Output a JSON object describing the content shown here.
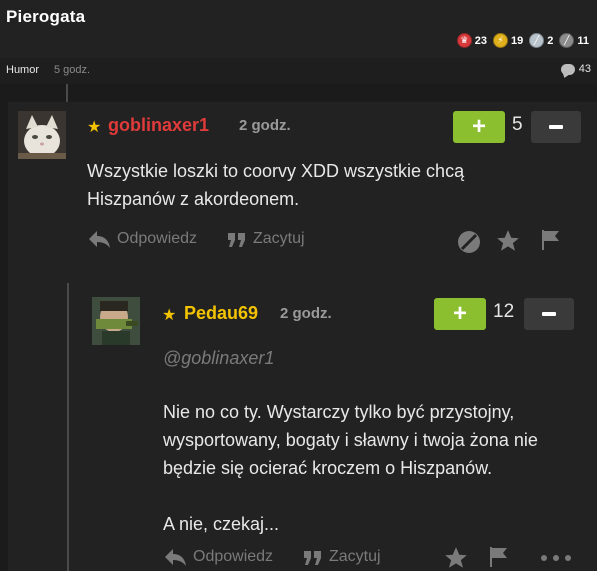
{
  "header": {
    "site_title": "Pierogata",
    "badges": [
      {
        "icon": "red-medal-icon",
        "count": "23",
        "color": "#d8393b"
      },
      {
        "icon": "gold-medal-icon",
        "count": "19",
        "color": "#e0b01c"
      },
      {
        "icon": "silver-medal-icon",
        "count": "2",
        "color": "#b8c3cc"
      },
      {
        "icon": "grey-medal-icon",
        "count": "11",
        "color": "#8c8c8c"
      }
    ]
  },
  "post_meta": {
    "category": "Humor",
    "time": "5 godz.",
    "comment_count": "43"
  },
  "comments": [
    {
      "username": "goblinaxer1",
      "username_color": "#e03a3a",
      "time": "2 godz.",
      "score": "5",
      "plus_label": "+",
      "text_lines": [
        "Wszystkie loszki to coorvy XDD wszystkie chcą",
        "Hiszpanów z akordeonem."
      ],
      "reply_label": "Odpowiedz",
      "quote_label": "Zacytuj"
    },
    {
      "username": "Pedau69",
      "username_color": "#f3c300",
      "time": "2 godz.",
      "score": "12",
      "plus_label": "+",
      "mention": "@goblinaxer1",
      "text_lines": [
        "Nie no co ty. Wystarczy tylko być przystojny,",
        "wysportowany, bogaty i sławny i twoja żona nie",
        "będzie się ocierać kroczem o Hiszpanów.",
        "",
        "A nie, czekaj..."
      ],
      "reply_label": "Odpowiedz",
      "quote_label": "Zacytuj"
    }
  ],
  "colors": {
    "accent_green": "#8bbf2f",
    "background": "#1b1b1b",
    "panel": "#222222"
  }
}
